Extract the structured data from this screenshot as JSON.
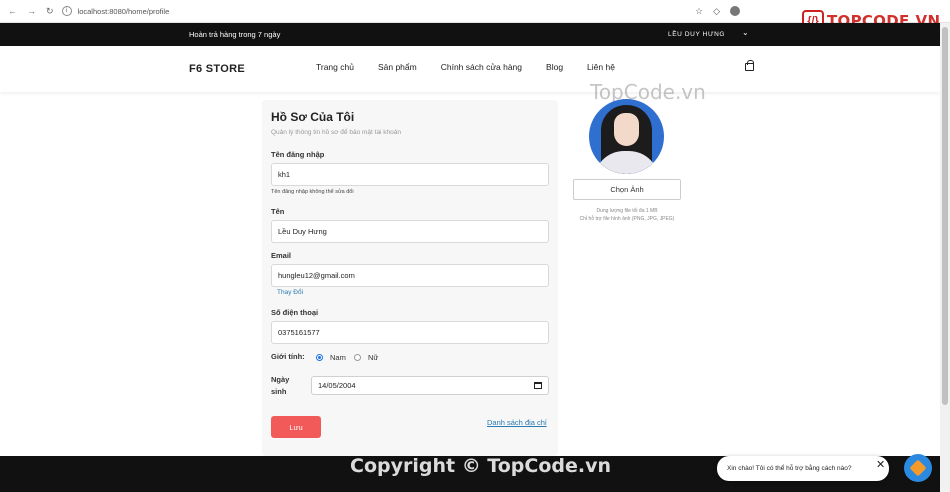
{
  "browser": {
    "url": "localhost:8080/home/profile"
  },
  "topbar": {
    "promo": "Hoàn trả hàng trong 7 ngày",
    "user": "LỀU DUY HƯNG",
    "chevron": "⌄"
  },
  "header": {
    "logo": "F6 STORE",
    "menu": [
      "Trang chủ",
      "Sản phẩm",
      "Chính sách cửa hàng",
      "Blog",
      "Liên hệ"
    ]
  },
  "profile": {
    "title": "Hồ Sơ Của Tôi",
    "subtitle": "Quản lý thông tin hồ sơ để bảo mật tài khoản",
    "username_label": "Tên đăng nhập",
    "username_value": "kh1",
    "username_note": "Tên đăng nhập không thể sửa đổi",
    "name_label": "Tên",
    "name_value": "Lều Duy Hưng",
    "email_label": "Email",
    "email_value": "hungleu12@gmail.com",
    "email_change": "Thay Đổi",
    "phone_label": "Số điện thoại",
    "phone_value": "0375161577",
    "gender_label": "Giới tính:",
    "gender_options": [
      "Nam",
      "Nữ"
    ],
    "gender_selected": "Nam",
    "dob_label": "Ngày sinh",
    "dob_value": "14/05/2004",
    "save_label": "Lưu",
    "address_link": "Danh sách địa chỉ"
  },
  "avatar": {
    "choose_label": "Chọn Ảnh",
    "hint_size": "Dung lượng file tối đa 1 MB",
    "hint_format": "Chỉ hỗ trợ file hình ảnh (PNG, JPG, JPEG)"
  },
  "watermark": {
    "center": "TopCode.vn",
    "brand": "TOPCODE.VN",
    "brand_icon": "{/}",
    "copyright": "Copyright © TopCode.vn"
  },
  "chat": {
    "message": "Xin chào! Tôi có thể hỗ trợ bằng cách nào?",
    "close": "✕"
  },
  "colors": {
    "topbar": "#111111",
    "save": "#f25a5a",
    "link": "#2a7ab0",
    "radio": "#1a73e8"
  }
}
